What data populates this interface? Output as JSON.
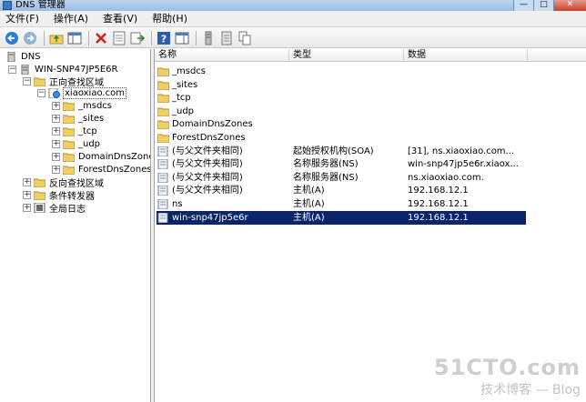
{
  "window": {
    "title": "DNS 管理器",
    "btn_min": "—",
    "btn_max": "□",
    "btn_close": "✕"
  },
  "menu": [
    {
      "label": "文件(F)"
    },
    {
      "label": "操作(A)"
    },
    {
      "label": "查看(V)"
    },
    {
      "label": "帮助(H)"
    }
  ],
  "tree": {
    "root": "DNS",
    "server": "WIN-SNP47JP5E6R",
    "forward_zones": "正向查找区域",
    "zone": "xiaoxiao.com",
    "zone_children": [
      "_msdcs",
      "_sites",
      "_tcp",
      "_udp",
      "DomainDnsZones",
      "ForestDnsZones"
    ],
    "reverse_zones": "反向查找区域",
    "forwarders": "条件转发器",
    "global_logs": "全局日志",
    "expander_plus": "+",
    "expander_minus": "−"
  },
  "list": {
    "headers": {
      "name": "名称",
      "type": "类型",
      "data": "数据"
    },
    "rows": [
      {
        "name": "_msdcs",
        "type": "",
        "data": "",
        "icon": "folder-icon"
      },
      {
        "name": "_sites",
        "type": "",
        "data": "",
        "icon": "folder-icon"
      },
      {
        "name": "_tcp",
        "type": "",
        "data": "",
        "icon": "folder-icon"
      },
      {
        "name": "_udp",
        "type": "",
        "data": "",
        "icon": "folder-icon"
      },
      {
        "name": "DomainDnsZones",
        "type": "",
        "data": "",
        "icon": "folder-icon"
      },
      {
        "name": "ForestDnsZones",
        "type": "",
        "data": "",
        "icon": "folder-icon"
      },
      {
        "name": "(与父文件夹相同)",
        "type": "起始授权机构(SOA)",
        "data": "[31], ns.xiaoxiao.com...",
        "icon": "record-icon"
      },
      {
        "name": "(与父文件夹相同)",
        "type": "名称服务器(NS)",
        "data": "win-snp47jp5e6r.xiaox...",
        "icon": "record-icon"
      },
      {
        "name": "(与父文件夹相同)",
        "type": "名称服务器(NS)",
        "data": "ns.xiaoxiao.com.",
        "icon": "record-icon"
      },
      {
        "name": "(与父文件夹相同)",
        "type": "主机(A)",
        "data": "192.168.12.1",
        "icon": "record-icon"
      },
      {
        "name": "ns",
        "type": "主机(A)",
        "data": "192.168.12.1",
        "icon": "record-icon"
      },
      {
        "name": "win-snp47jp5e6r",
        "type": "主机(A)",
        "data": "192.168.12.1",
        "icon": "record-icon",
        "selected": true
      }
    ]
  },
  "watermark": {
    "logo": "51CTO.com",
    "sub": "技术博客 — Blog"
  },
  "colors": {
    "selection": "#0a246a",
    "folder": "#f2cf63",
    "back_arrow": "#2d7bd4",
    "delete_x": "#d42020"
  }
}
